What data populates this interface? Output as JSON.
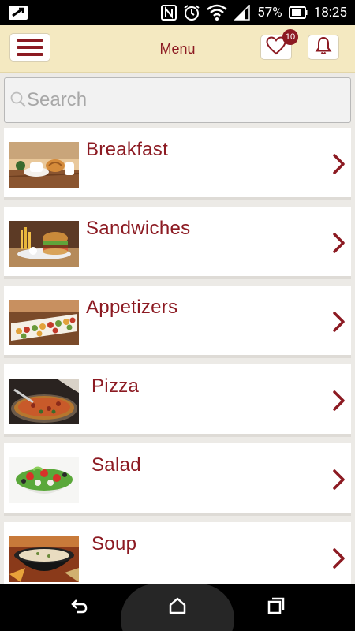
{
  "status_bar": {
    "battery_text": "57%",
    "time": "18:25",
    "icons": [
      "screen-mirror-icon",
      "nfc-icon",
      "alarm-icon",
      "wifi-icon",
      "signal-icon",
      "battery-icon"
    ]
  },
  "header": {
    "title": "Menu",
    "favorites_count": "10",
    "icons": [
      "hamburger-icon",
      "heart-icon",
      "bell-icon"
    ]
  },
  "search": {
    "placeholder": "Search",
    "value": ""
  },
  "menu": {
    "items": [
      {
        "label": "Breakfast",
        "image": "breakfast-photo"
      },
      {
        "label": "Sandwiches",
        "image": "sandwiches-photo"
      },
      {
        "label": "Appetizers",
        "image": "appetizers-photo"
      },
      {
        "label": "Pizza",
        "image": "pizza-photo"
      },
      {
        "label": "Salad",
        "image": "salad-photo"
      },
      {
        "label": "Soup",
        "image": "soup-photo"
      }
    ]
  },
  "colors": {
    "accent": "#8c1a22",
    "header_bg": "#f4e9c1",
    "page_bg": "#eceae6"
  },
  "nav_bar": {
    "icons": [
      "back-icon",
      "home-icon",
      "recents-icon"
    ]
  }
}
